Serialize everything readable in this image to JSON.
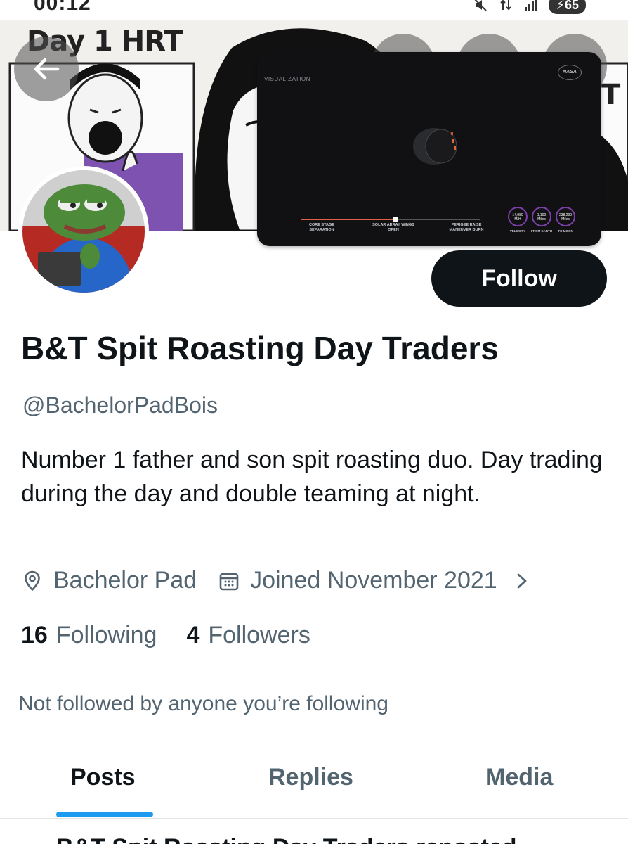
{
  "status_bar": {
    "time": "00:12",
    "battery": "65",
    "icons": [
      "mute-icon",
      "data-arrows-icon",
      "signal-icon",
      "battery-icon"
    ]
  },
  "banner": {
    "caption": "Day 1 HRT"
  },
  "video": {
    "tag": "VISUALIZATION",
    "logo": "NASA",
    "milestones": [
      "CORE STAGE SEPARATION",
      "SOLAR ARRAY WINGS OPEN",
      "PERIGEE RAISE MANEUVER BURN"
    ],
    "gauges": [
      {
        "value": "14,980",
        "unit": "M/H",
        "label": "VELOCITY"
      },
      {
        "value": "1,100",
        "unit": "Miles",
        "label": "FROM EARTH"
      },
      {
        "value": "238,290",
        "unit": "Miles",
        "label": "TO MOON"
      }
    ]
  },
  "profile": {
    "follow_label": "Follow",
    "display_name": "B&T Spit Roasting Day Traders",
    "handle": "@BachelorPadBois",
    "bio": "Number 1 father and son spit roasting duo. Day trading during the day and double teaming at night.",
    "location": "Bachelor Pad",
    "joined": "Joined November 2021",
    "following_count": "16",
    "following_label": "Following",
    "followers_count": "4",
    "followers_label": "Followers",
    "not_followed": "Not followed by anyone you’re following"
  },
  "tabs": [
    {
      "label": "Posts",
      "active": true
    },
    {
      "label": "Replies",
      "active": false
    },
    {
      "label": "Media",
      "active": false
    }
  ],
  "next_post_preview": "B&T Spit Roasting Day Traders reposted",
  "colors": {
    "text": "#0f1419",
    "secondary": "#536471",
    "accent": "#1d9bf0",
    "follow_bg": "#0f1419"
  }
}
